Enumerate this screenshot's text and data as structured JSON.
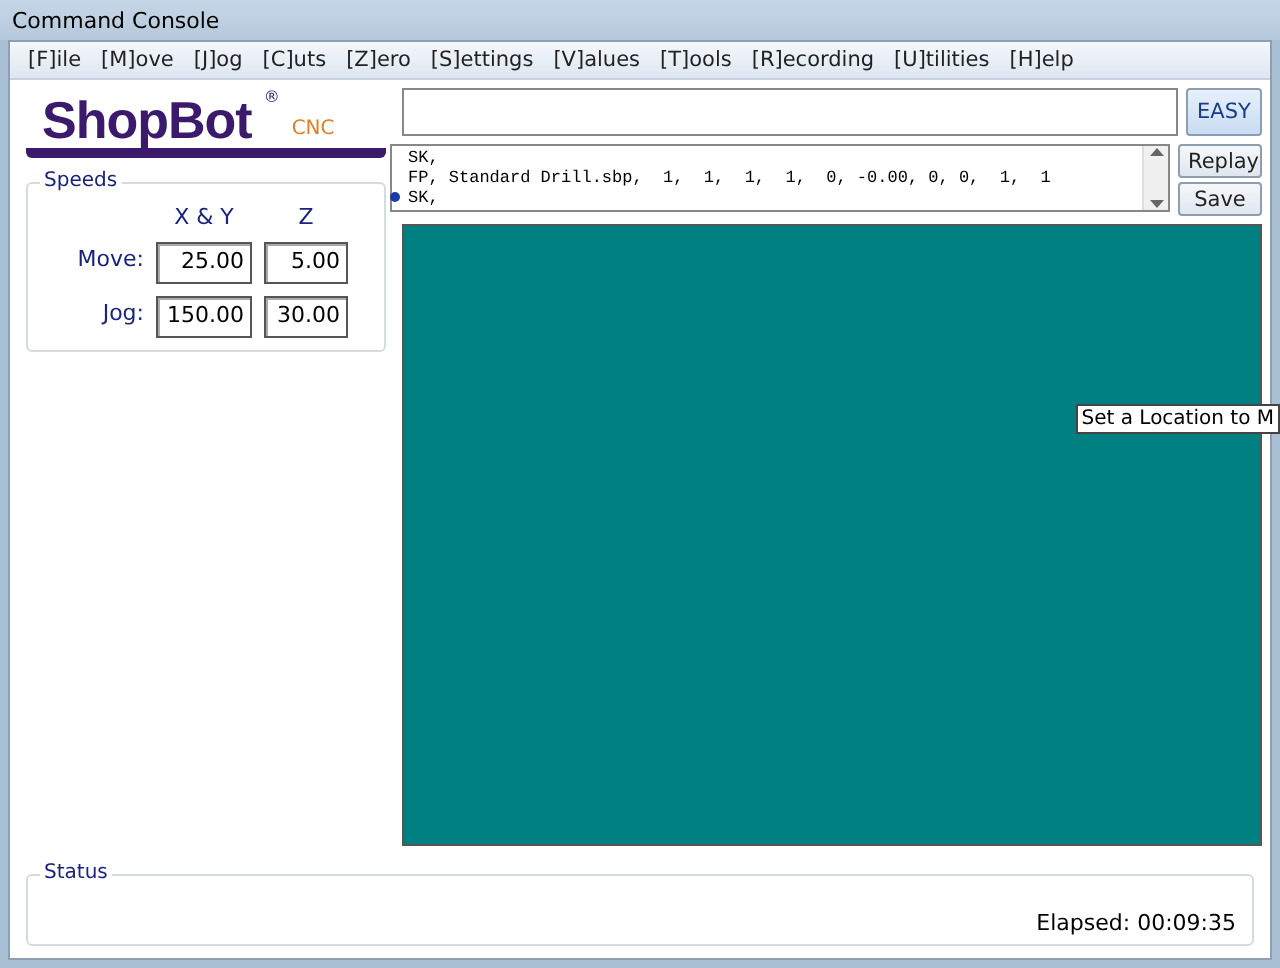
{
  "window": {
    "title": "Command Console"
  },
  "menu": [
    "[F]ile",
    "[M]ove",
    "[J]og",
    "[C]uts",
    "[Z]ero",
    "[S]ettings",
    "[V]alues",
    "[T]ools",
    "[R]ecording",
    "[U]tilities",
    "[H]elp"
  ],
  "logo": {
    "name": "ShopBot",
    "mark": "®",
    "suffix": "CNC"
  },
  "command": {
    "button": "EASY"
  },
  "console": {
    "lines": [
      {
        "text": "SK,",
        "current": false
      },
      {
        "text": "FP, Standard Drill.sbp,  1,  1,  1,  1,  0, -0.00, 0, 0,  1,  1",
        "current": false
      },
      {
        "text": "SK,",
        "current": true
      }
    ],
    "buttons": [
      "Replay",
      "Save"
    ]
  },
  "speeds": {
    "title": "Speeds",
    "columns": [
      "X & Y",
      "Z"
    ],
    "rows": [
      {
        "label": "Move:",
        "values": [
          "25.00",
          "5.00"
        ]
      },
      {
        "label": "Jog:",
        "values": [
          "150.00",
          "30.00"
        ]
      }
    ]
  },
  "tooltip": "Set a Location to M",
  "status": {
    "title": "Status",
    "elapsed": "Elapsed: 00:09:35"
  }
}
